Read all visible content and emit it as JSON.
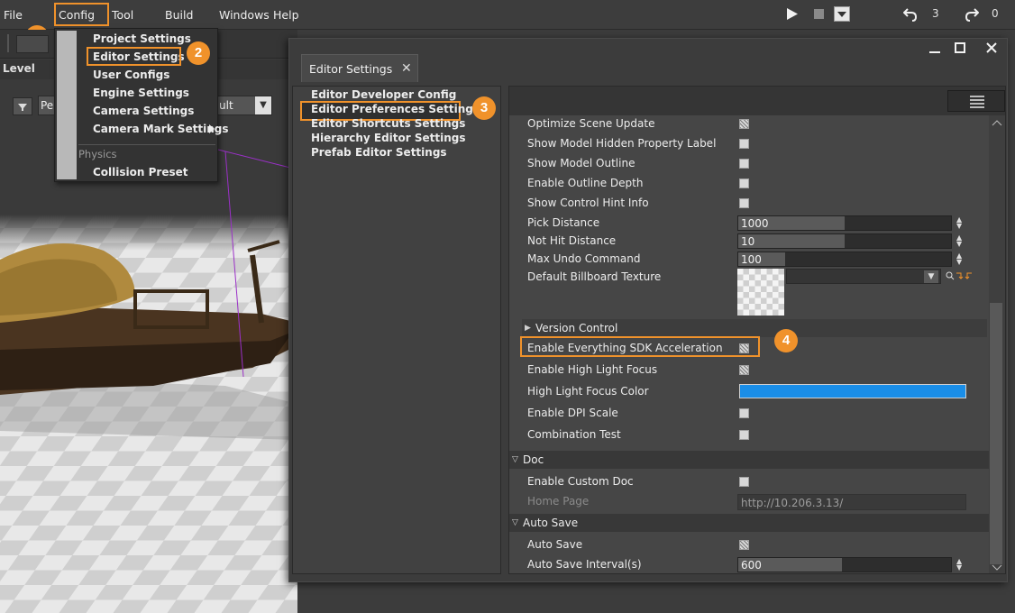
{
  "menubar": {
    "items": [
      "File",
      "Config",
      "Tool",
      "Build",
      "Windows",
      "Help"
    ],
    "undo_count": "3",
    "redo_count": "0"
  },
  "badges": [
    "1",
    "2",
    "3",
    "4"
  ],
  "level_label": "Level",
  "viewport": {
    "view_mode_partial": "Pe",
    "lighting_partial": "ult"
  },
  "config_menu": {
    "items": [
      "Project Settings",
      "Editor Settings",
      "User Configs",
      "Engine Settings",
      "Camera Settings",
      "Camera Mark Settings"
    ],
    "section": "Physics",
    "physics_items": [
      "Collision Preset"
    ]
  },
  "settings_window": {
    "tab_title": "Editor Settings",
    "categories": [
      "Editor Developer Config",
      "Editor Preferences Settings",
      "Editor Shortcuts Settings",
      "Hierarchy Editor Settings",
      "Prefab Editor Settings"
    ],
    "properties_top": [
      {
        "label": "Optimize Scene Update",
        "checked": true
      },
      {
        "label": "Show Model Hidden Property Label",
        "checked": false
      },
      {
        "label": "Show Model Outline",
        "checked": false
      },
      {
        "label": "Enable Outline Depth",
        "checked": false
      },
      {
        "label": "Show Control Hint Info",
        "checked": false
      }
    ],
    "numeric_props": [
      {
        "label": "Pick Distance",
        "value": "1000"
      },
      {
        "label": "Not Hit Distance",
        "value": "10"
      },
      {
        "label": "Max Undo Command",
        "value": "100"
      }
    ],
    "billboard_label": "Default Billboard Texture",
    "version_control_label": "Version Control",
    "version_props": [
      {
        "label": "Enable Everything SDK Acceleration",
        "checked": true
      },
      {
        "label": "Enable High Light Focus",
        "checked": true
      },
      {
        "label": "High Light Focus Color",
        "color": "#1a8ee8"
      },
      {
        "label": "Enable DPI Scale",
        "checked": false
      },
      {
        "label": "Combination Test",
        "checked": false
      }
    ],
    "doc_section": "Doc",
    "doc_props": [
      {
        "label": "Enable Custom Doc",
        "checked": false
      },
      {
        "label": "Home Page",
        "value": "http://10.206.3.13/"
      }
    ],
    "autosave_section": "Auto Save",
    "autosave_props": [
      {
        "label": "Auto Save",
        "checked": true
      },
      {
        "label": "Auto Save Interval(s)",
        "value": "600"
      }
    ]
  },
  "colors": {
    "highlight": "#f0922b",
    "accent_blue": "#1a8ee8"
  }
}
